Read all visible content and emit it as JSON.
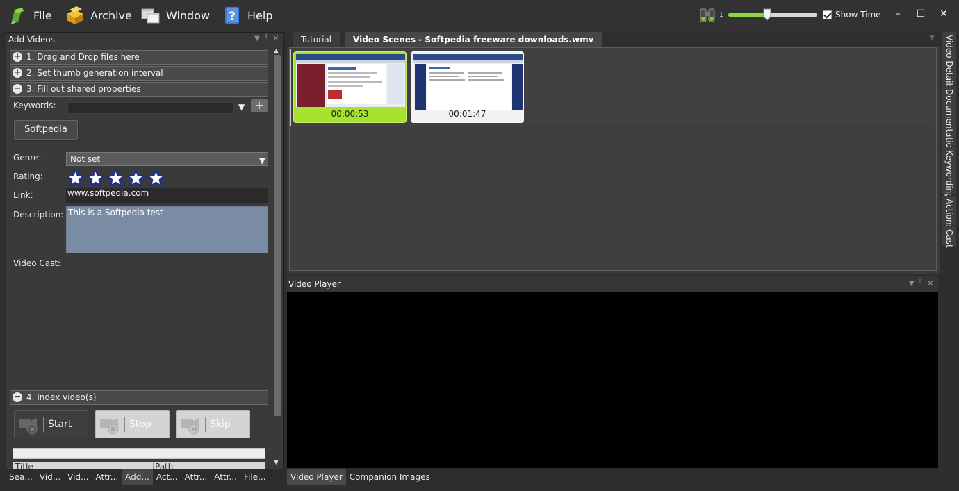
{
  "menu": {
    "file": "File",
    "archive": "Archive",
    "window": "Window",
    "help": "Help"
  },
  "toolbar": {
    "zoom_value": "1",
    "slider_level_pct": 44,
    "show_time_label": "Show Time",
    "show_time_checked": true,
    "minimize": "–",
    "maximize": "☐",
    "close": "✕"
  },
  "add_videos": {
    "title": "Add Videos",
    "sections": [
      {
        "symbol": "+",
        "label": "1. Drag and Drop files here"
      },
      {
        "symbol": "+",
        "label": "2. Set thumb generation interval"
      },
      {
        "symbol": "−",
        "label": "3. Fill out shared properties"
      },
      {
        "symbol": "−",
        "label": "4. Index video(s)"
      }
    ],
    "keywords_label": "Keywords:",
    "keyword_tag": "Softpedia",
    "genre_label": "Genre:",
    "genre_value": "Not set",
    "rating_label": "Rating:",
    "rating_stars": 5,
    "link_label": "Link:",
    "link_value": "www.softpedia.com",
    "description_label": "Description:",
    "description_value": "This is a Softpedia test",
    "video_cast_label": "Video Cast:",
    "start_label": "Start",
    "stop_label": "Stop",
    "skip_label": "Skip",
    "table_columns": [
      "Title",
      "Path"
    ]
  },
  "left_tabs": [
    "Sea...",
    "Vid...",
    "Vid...",
    "Attr...",
    "Add...",
    "Act...",
    "Attr...",
    "Attr...",
    "File..."
  ],
  "left_active_tab": 4,
  "scenes": {
    "tabs": [
      "Tutorial",
      "Video Scenes - Softpedia freeware downloads.wmv"
    ],
    "active_tab": 1,
    "thumbnails": [
      {
        "time": "00:00:53",
        "selected": true
      },
      {
        "time": "00:01:47",
        "selected": false
      }
    ]
  },
  "right_tabs": [
    "Video Details",
    "Documentation",
    "Keywording",
    "Actions",
    "Cast"
  ],
  "player": {
    "title": "Video Player",
    "tabs": [
      "Video Player",
      "Companion Images"
    ],
    "active_tab": 0
  },
  "colors": {
    "accent_green": "#a6e22e",
    "description_bg": "#7a8ca3",
    "star_blue": "#1b2f9e"
  }
}
